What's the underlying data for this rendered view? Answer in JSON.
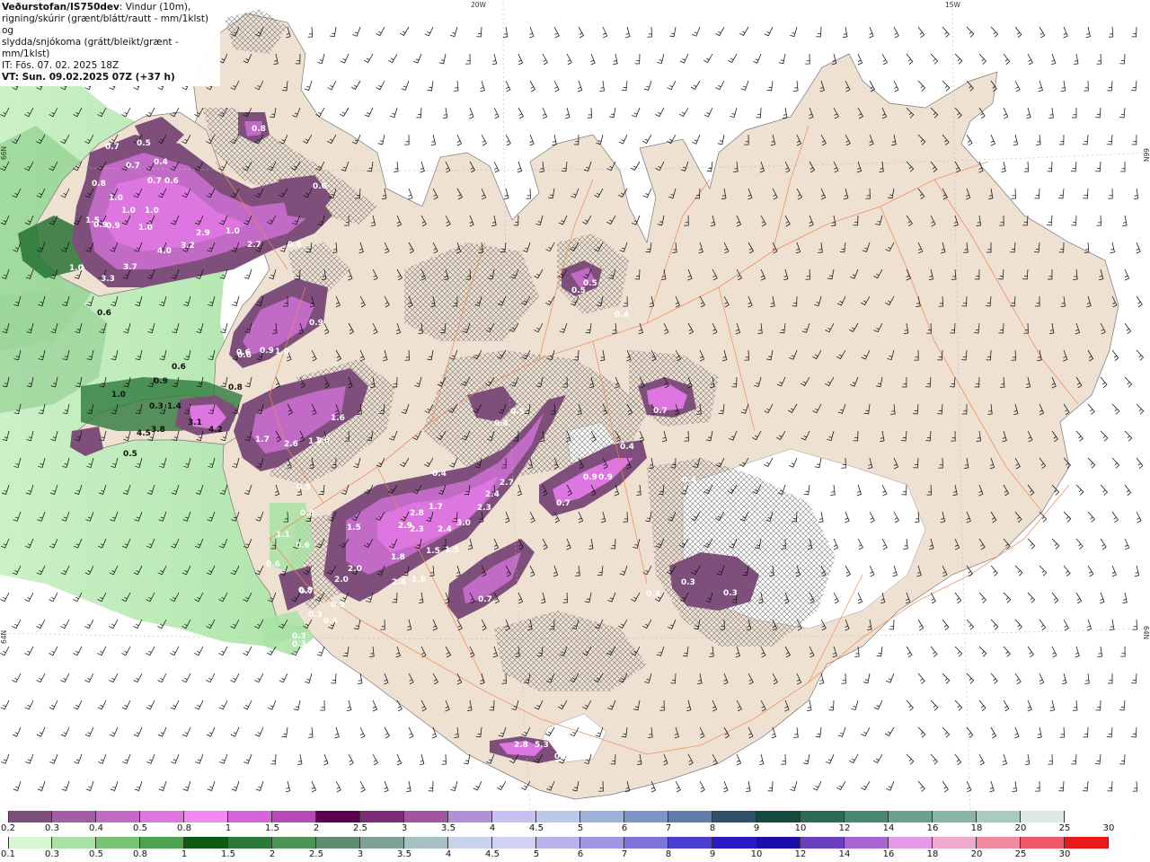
{
  "header": {
    "brand": "Veðurstofan/IS750dev",
    "line1_rest": ": Vindur (10m),",
    "line2": "rigning/skúrir (grænt/blátt/rautt - mm/1klst) og",
    "line3": "slydda/snjókoma (grátt/bleikt/grænt - mm/1klst)",
    "it": "IT: Fös. 07. 02. 2025 18Z",
    "vt": "VT: Sun. 09.02.2025 07Z (+37 h)"
  },
  "grid_labels": {
    "lon_20w": "20W",
    "lon_15w": "15W",
    "lat_66n_left": "66N",
    "lat_66n_right": "66N",
    "lat_64n_left": "64N",
    "lat_64n_right": "64N"
  },
  "colors": {
    "land": "#efe1d2",
    "sea": "#ffffff",
    "roads": "#ee8855",
    "sleet_light_green": "#b9ebb6",
    "snow_purple": "#c455c8"
  },
  "precip_labels": [
    {
      "text": "0.5"
    },
    {
      "text": "0.4"
    },
    {
      "text": "0.7"
    },
    {
      "text": "0.7"
    },
    {
      "text": "0.7"
    },
    {
      "text": "0.6"
    },
    {
      "text": "1.0"
    },
    {
      "text": "0.9"
    },
    {
      "text": "1.0"
    },
    {
      "text": "1.0"
    },
    {
      "text": "0.8"
    },
    {
      "text": "0.9"
    },
    {
      "text": "1.5"
    },
    {
      "text": "1.0"
    },
    {
      "text": "3.2"
    },
    {
      "text": "4.0"
    },
    {
      "text": "2.9"
    },
    {
      "text": "1.0"
    },
    {
      "text": "2.7"
    },
    {
      "text": "0.6"
    },
    {
      "text": "0.6"
    },
    {
      "text": "3.7"
    },
    {
      "text": "1.0"
    },
    {
      "text": "3.3"
    },
    {
      "text": "0.6"
    },
    {
      "text": "0.8"
    },
    {
      "text": "0.6"
    },
    {
      "text": "0.9"
    },
    {
      "text": "1.0"
    },
    {
      "text": "0.9"
    },
    {
      "text": "0.6"
    },
    {
      "text": "0.6"
    },
    {
      "text": "0.9"
    },
    {
      "text": "1.0"
    },
    {
      "text": "0.8"
    },
    {
      "text": "0.3"
    },
    {
      "text": "1.4"
    },
    {
      "text": "3.1"
    },
    {
      "text": "4.2"
    },
    {
      "text": "4.5"
    },
    {
      "text": "3.8"
    },
    {
      "text": "0.5"
    },
    {
      "text": "1.7"
    },
    {
      "text": "2.6"
    },
    {
      "text": "1.7"
    },
    {
      "text": "1.6"
    },
    {
      "text": "1.6"
    },
    {
      "text": "0.5"
    },
    {
      "text": "0.4"
    },
    {
      "text": "0.4"
    },
    {
      "text": "0.5"
    },
    {
      "text": "2.7"
    },
    {
      "text": "2.4"
    },
    {
      "text": "2.8"
    },
    {
      "text": "1.7"
    },
    {
      "text": "2.9"
    },
    {
      "text": "2.3"
    },
    {
      "text": "2.4"
    },
    {
      "text": "3.0"
    },
    {
      "text": "2.3"
    },
    {
      "text": "1.5"
    },
    {
      "text": "1.8"
    },
    {
      "text": "1.5"
    },
    {
      "text": "1.5"
    },
    {
      "text": "2.0"
    },
    {
      "text": "2.0"
    },
    {
      "text": "2.4"
    },
    {
      "text": "1.8"
    },
    {
      "text": "0.7"
    },
    {
      "text": "0.7"
    },
    {
      "text": "0.4"
    },
    {
      "text": "0.9"
    },
    {
      "text": "0.9"
    },
    {
      "text": "0.7"
    },
    {
      "text": "0.4"
    },
    {
      "text": "0.3"
    },
    {
      "text": "0.3"
    },
    {
      "text": "0.4"
    },
    {
      "text": "0.5"
    },
    {
      "text": "0.5"
    },
    {
      "text": "0.4"
    },
    {
      "text": "0.6"
    },
    {
      "text": "2.8"
    },
    {
      "text": "5.3"
    },
    {
      "text": "0.9"
    },
    {
      "text": "0.8"
    },
    {
      "text": "0.7"
    },
    {
      "text": "0.5"
    },
    {
      "text": "0.3"
    },
    {
      "text": "0.4"
    },
    {
      "text": "0.3"
    },
    {
      "text": "0.6"
    },
    {
      "text": "0.8"
    },
    {
      "text": "0.3"
    },
    {
      "text": "1.1"
    }
  ],
  "legend_snow": {
    "labels": [
      "0.2",
      "0.3",
      "0.4",
      "0.5",
      "0.8",
      "1",
      "1.5",
      "2",
      "2.5",
      "3",
      "3.5",
      "4",
      "4.5",
      "5",
      "6",
      "7",
      "8",
      "9",
      "10",
      "12",
      "14",
      "16",
      "18",
      "20",
      "25",
      "30"
    ],
    "colors": [
      "#7d4f7a",
      "#a25ea4",
      "#c26bc6",
      "#dd76e0",
      "#f28af2",
      "#d565d9",
      "#b649b8",
      "#5a0050",
      "#7b2e77",
      "#a255a0",
      "#b190d8",
      "#c8c0f0",
      "#bcc8ea",
      "#9cb2d8",
      "#7f95c6",
      "#5e7ca8",
      "#2e506d",
      "#124a3e",
      "#2d6b58",
      "#4a8770",
      "#6aa18c",
      "#87b6a4",
      "#a8cbbc",
      "#dce8e6"
    ]
  },
  "legend_rain": {
    "labels": [
      "0.1",
      "0.3",
      "0.5",
      "0.8",
      "1",
      "1.5",
      "2",
      "2.5",
      "3",
      "3.5",
      "4",
      "4.5",
      "5",
      "6",
      "7",
      "8",
      "9",
      "10",
      "12",
      "14",
      "16",
      "18",
      "20",
      "25",
      "30"
    ],
    "colors": [
      "#d8f5d4",
      "#a9e0a4",
      "#78c377",
      "#4ea14e",
      "#0e5a14",
      "#2d7a38",
      "#4b9456",
      "#5e8d73",
      "#7ea296",
      "#a8bfc2",
      "#c7d3e8",
      "#d2d3f2",
      "#b6b4ec",
      "#9d97e4",
      "#7e75dc",
      "#4b3fd2",
      "#2a19c4",
      "#1a0fa8",
      "#6a3fc0",
      "#a765d4",
      "#e29ae6",
      "#f0aace",
      "#f08a9c",
      "#ec5a6a",
      "#e81a1a"
    ]
  }
}
